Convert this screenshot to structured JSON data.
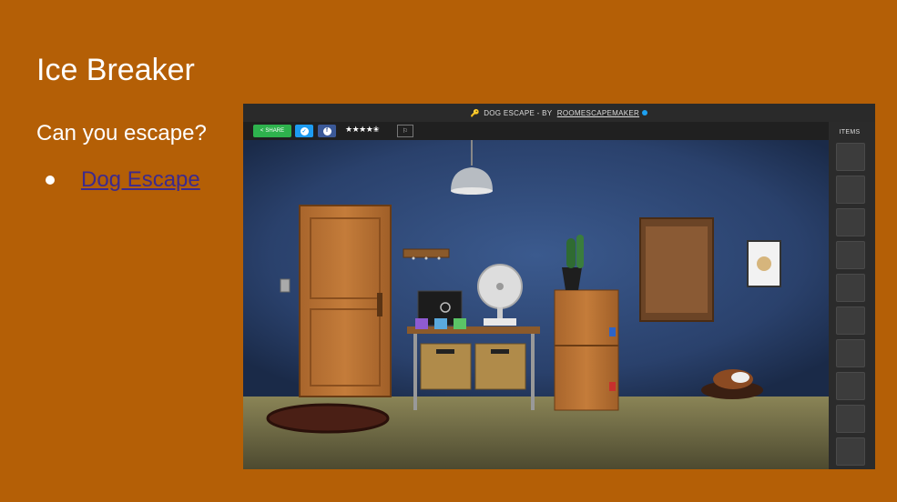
{
  "slide": {
    "title": "Ice Breaker",
    "subtitle": "Can you escape?",
    "link_text": "Dog Escape"
  },
  "game": {
    "title": "DOG ESCAPE",
    "by_prefix": " - BY ",
    "author": "ROOMESCAPEMAKER",
    "share_label": "SHARE",
    "rating_stars": "★★★★✬",
    "items_label": "ITEMS",
    "item_slots": 10
  },
  "colors": {
    "background": "#b45f06",
    "link": "#3d2a8c",
    "wall": "#2d4470",
    "share": "#2eb24d",
    "twitter": "#1d9bf0",
    "facebook": "#3b5998"
  }
}
